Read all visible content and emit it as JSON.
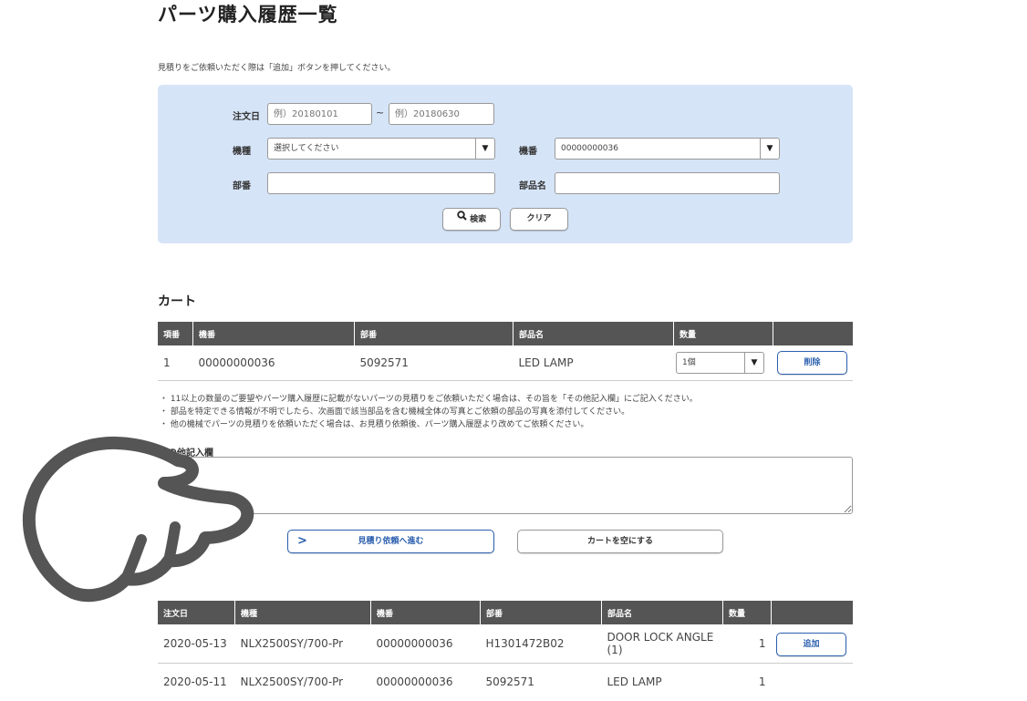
{
  "page_title": "パーツ購入履歴一覧",
  "intro": "見積りをご依頼いただく際は「追加」ボタンを押してください。",
  "search": {
    "order_date_label": "注文日",
    "date_from_placeholder": "例）20180101",
    "tilde": "~",
    "date_to_placeholder": "例）20180630",
    "model_label": "機種",
    "model_value": "選択してください",
    "machine_no_label": "機番",
    "machine_no_value": "00000000036",
    "part_no_label": "部番",
    "part_name_label": "部品名",
    "search_button": "検索",
    "clear_button": "クリア"
  },
  "cart": {
    "heading": "カート",
    "columns": [
      "項番",
      "機番",
      "部番",
      "部品名",
      "数量"
    ],
    "rows": [
      {
        "no": "1",
        "machine_no": "00000000036",
        "part_no": "5092571",
        "part_name": "LED LAMP",
        "qty": "1個",
        "delete_label": "削除"
      }
    ],
    "notes": [
      "11以上の数量のご要望やパーツ購入履歴に記載がないパーツの見積りをご依頼いただく場合は、その旨を「その他記入欄」にご記入ください。",
      "部品を特定できる情報が不明でしたら、次画面で該当部品を含む機械全体の写真とご依頼の部品の写真を添付してください。",
      "他の機械でパーツの見積りを依頼いただく場合は、お見積り依頼後、パーツ購入履歴より改めてご依頼ください。"
    ],
    "memo_label": "その他記入欄",
    "proceed_button": "見積り依頼へ進む",
    "empty_button": "カートを空にする"
  },
  "history": {
    "columns": [
      "注文日",
      "機種",
      "機番",
      "部番",
      "部品名",
      "数量"
    ],
    "rows": [
      {
        "date": "2020-05-13",
        "model": "NLX2500SY/700-Pr",
        "machine_no": "00000000036",
        "part_no": "H1301472B02",
        "part_name": "DOOR LOCK ANGLE (1)",
        "qty": "1",
        "add_label": "追加"
      },
      {
        "date": "2020-05-11",
        "model": "NLX2500SY/700-Pr",
        "machine_no": "00000000036",
        "part_no": "5092571",
        "part_name": "LED LAMP",
        "qty": "1",
        "add_label": ""
      }
    ]
  },
  "colors": {
    "accent": "#2b5fae",
    "panel": "#d6e4f7",
    "table_header": "#555555"
  },
  "icons": {
    "search": "search-icon",
    "proceed": "chevron-right-icon",
    "hand": "pointing-hand-icon"
  }
}
